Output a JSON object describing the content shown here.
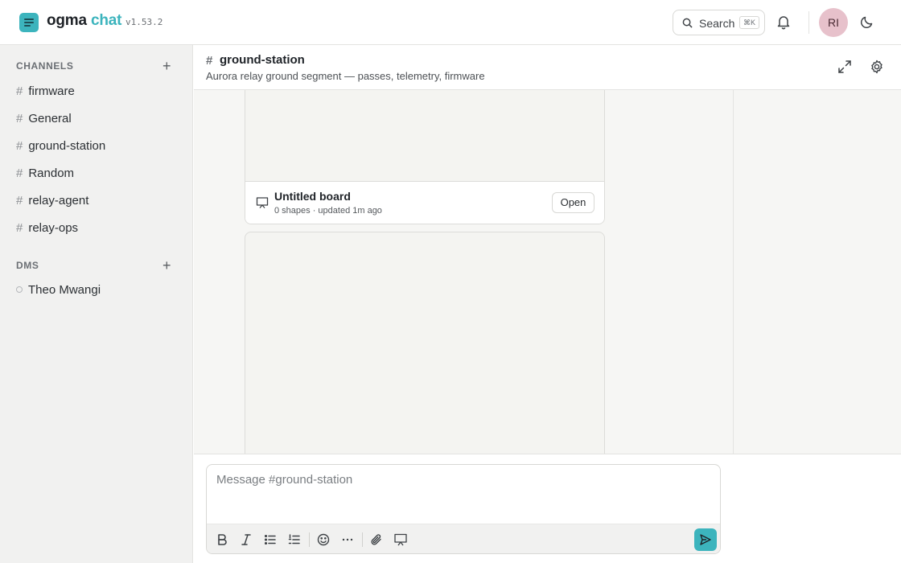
{
  "app": {
    "brand_part1": "ogma",
    "brand_part2": "chat",
    "version": "v1.53.2",
    "accent_color": "#3cb4bd"
  },
  "topbar": {
    "search_label": "Search",
    "search_shortcut": "⌘K",
    "avatar_initials": "RI",
    "icons": [
      "search-icon",
      "bell-icon",
      "moon-icon"
    ]
  },
  "sidebar": {
    "channels_heading": "CHANNELS",
    "channels": [
      {
        "hash": "#",
        "name": "firmware"
      },
      {
        "hash": "#",
        "name": "General"
      },
      {
        "hash": "#",
        "name": "ground-station"
      },
      {
        "hash": "#",
        "name": "Random"
      },
      {
        "hash": "#",
        "name": "relay-agent"
      },
      {
        "hash": "#",
        "name": "relay-ops"
      }
    ],
    "dms_heading": "DMS",
    "add_symbol": "+",
    "dms": [
      {
        "name": "Theo Mwangi",
        "status": "offline"
      }
    ]
  },
  "channel_header": {
    "hash": "#",
    "name": "ground-station",
    "description": "Aurora relay ground segment — passes, telemetry, firmware"
  },
  "messages": {
    "board": {
      "title": "Untitled board",
      "meta": "0 shapes · updated 1m ago",
      "open_label": "Open"
    }
  },
  "composer": {
    "placeholder": "Message #ground-station",
    "tools": [
      "bold-icon",
      "italic-icon",
      "bullet-list-icon",
      "numbered-list-icon",
      "emoji-icon",
      "more-icon",
      "attach-icon",
      "whiteboard-icon",
      "send-icon"
    ]
  }
}
